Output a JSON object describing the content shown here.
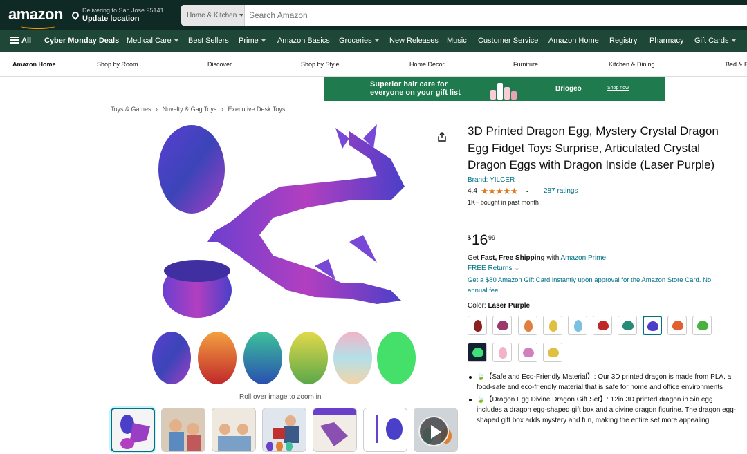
{
  "header": {
    "logo": "amazon",
    "deliver_line1": "Delivering to San Jose 95141",
    "deliver_line2": "Update location",
    "search_department": "Home & Kitchen",
    "search_placeholder": "Search Amazon"
  },
  "nav": {
    "all": "All",
    "items": [
      "Cyber Monday Deals",
      "Medical Care",
      "Best Sellers",
      "Prime",
      "Amazon Basics",
      "Groceries",
      "New Releases",
      "Music",
      "Customer Service",
      "Amazon Home",
      "Registry",
      "Pharmacy",
      "Gift Cards"
    ]
  },
  "subnav": {
    "items": [
      "Amazon Home",
      "Shop by Room",
      "Discover",
      "Shop by Style",
      "Home Décor",
      "Furniture",
      "Kitchen & Dining",
      "Bed & B"
    ]
  },
  "banner": {
    "text_line1": "Superior hair care for",
    "text_line2": "everyone on your gift list",
    "brand": "Briogeo",
    "cta": "Shop now"
  },
  "breadcrumbs": [
    "Toys & Games",
    "›",
    "Novelty & Gag Toys",
    "›",
    "Executive Desk Toys"
  ],
  "gallery": {
    "zoom_hint": "Roll over image to zoom in",
    "thumb_count": 7
  },
  "product": {
    "title": "3D Printed Dragon Egg, Mystery Crystal Dragon Egg Fidget Toys Surprise, Articulated Crystal Dragon Eggs with Dragon Inside (Laser Purple)",
    "brand": "Brand: YILCER",
    "rating": "4.4",
    "stars": "★★★★★",
    "rating_count": "287 ratings",
    "bought": "1K+ bought in past month",
    "price_symbol": "$",
    "price_whole": "16",
    "price_fraction": "99",
    "shipping_prefix": "Get ",
    "shipping_bold": "Fast, Free Shipping",
    "shipping_mid": " with ",
    "shipping_link": "Amazon Prime",
    "returns": "FREE Returns",
    "gift_card": "Get a $80 Amazon Gift Card instantly upon approval for the Amazon Store Card. No annual fee.",
    "color_label": "Color: ",
    "color_value": "Laser Purple",
    "swatch_count": 14,
    "selected_swatch": 7
  },
  "bullets": [
    "【Safe and Eco-Friendly Material】: Our 3D printed dragon is made from PLA, a food-safe and eco-friendly material that is safe for home and office environments",
    "【Dragon Egg Divine Dragon Gift Set】: 12in 3D printed dragon in 5in egg includes a dragon egg-shaped gift box and a divine dragon figurine. The dragon egg-shaped gift box adds mystery and fun, making the entire set more appealing."
  ],
  "colors": {
    "header_bg": "#0f2a24",
    "nav_bg": "#1f4738",
    "link": "#007185",
    "star": "#de7921",
    "banner_bg": "#1f7a4e"
  }
}
